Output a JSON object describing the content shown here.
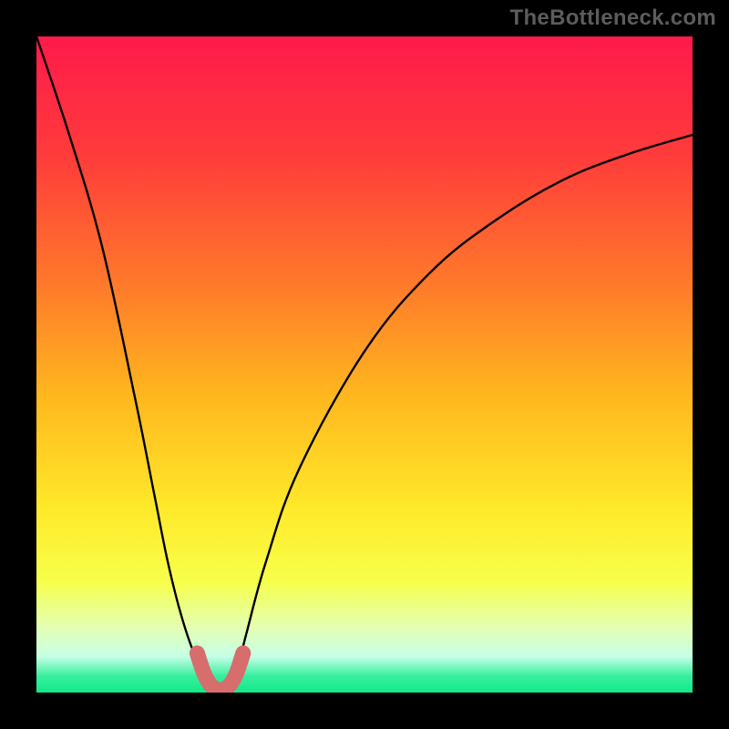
{
  "watermark": "TheBottleneck.com",
  "colors": {
    "frame": "#000000",
    "curve": "#000000",
    "highlight": "#d86d6d",
    "gradient_stops": [
      {
        "offset": 0.0,
        "color": "#ff1a4b"
      },
      {
        "offset": 0.18,
        "color": "#ff3b3b"
      },
      {
        "offset": 0.38,
        "color": "#ff7a2a"
      },
      {
        "offset": 0.55,
        "color": "#ffb81e"
      },
      {
        "offset": 0.72,
        "color": "#ffe92a"
      },
      {
        "offset": 0.83,
        "color": "#f7ff4a"
      },
      {
        "offset": 0.9,
        "color": "#e4ffb2"
      },
      {
        "offset": 0.945,
        "color": "#c6ffe6"
      },
      {
        "offset": 0.975,
        "color": "#37ef9e"
      },
      {
        "offset": 1.0,
        "color": "#12e888"
      }
    ]
  },
  "chart_data": {
    "type": "line",
    "title": "",
    "xlabel": "",
    "ylabel": "",
    "xlim": [
      0,
      100
    ],
    "ylim": [
      0,
      100
    ],
    "grid": false,
    "series": [
      {
        "name": "bottleneck-curve",
        "x": [
          0,
          5,
          10,
          15,
          18,
          20,
          22,
          24,
          26,
          27,
          28,
          29,
          30,
          31,
          32,
          35,
          40,
          50,
          60,
          70,
          80,
          90,
          100
        ],
        "y": [
          100,
          85,
          68,
          45,
          30,
          20,
          12,
          6,
          2,
          0.5,
          0,
          0.5,
          2,
          5,
          9,
          20,
          34,
          52,
          64,
          72,
          78,
          82,
          85
        ]
      },
      {
        "name": "optimal-region",
        "x": [
          24.5,
          25.5,
          26.5,
          27.5,
          28,
          28.5,
          29.5,
          30.5,
          31.5
        ],
        "y": [
          6,
          3,
          1.2,
          0.4,
          0,
          0.4,
          1.2,
          3,
          6
        ]
      }
    ],
    "optimal_x": 28
  }
}
